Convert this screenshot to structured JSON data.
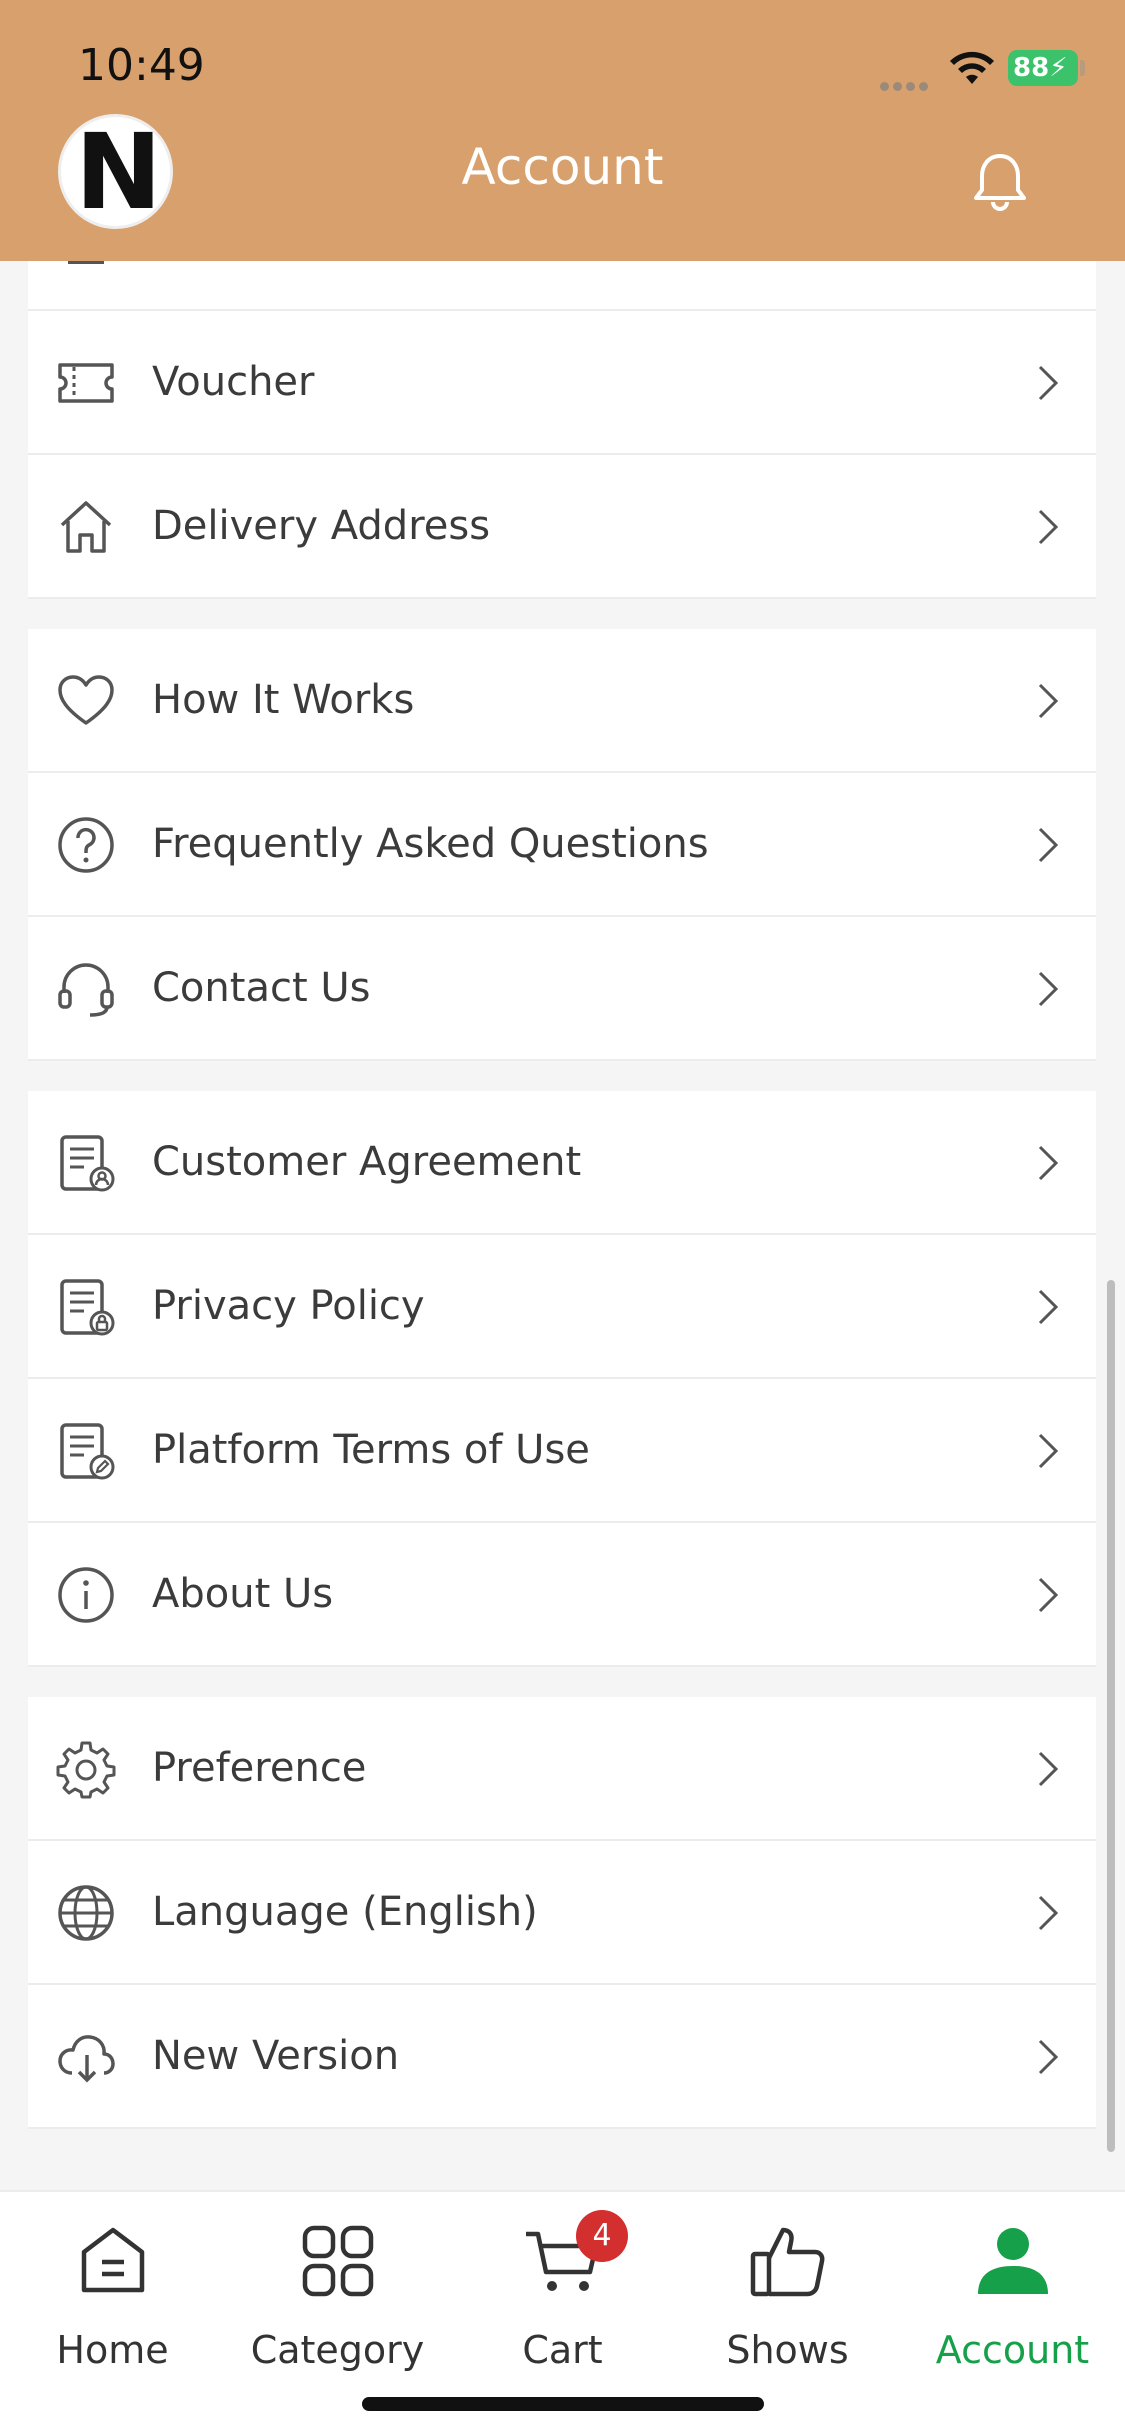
{
  "status_bar": {
    "time": "10:49",
    "battery": "88"
  },
  "header": {
    "logo_letter": "N",
    "title": "Account"
  },
  "groups": [
    {
      "items": [
        {
          "id": "voucher",
          "label": "Voucher",
          "icon": "ticket-icon"
        },
        {
          "id": "delivery-address",
          "label": "Delivery Address",
          "icon": "home-icon"
        }
      ]
    },
    {
      "items": [
        {
          "id": "how-it-works",
          "label": "How It Works",
          "icon": "heart-icon"
        },
        {
          "id": "faq",
          "label": "Frequently Asked Questions",
          "icon": "question-circle-icon"
        },
        {
          "id": "contact-us",
          "label": "Contact Us",
          "icon": "headset-icon"
        }
      ]
    },
    {
      "items": [
        {
          "id": "customer-agreement",
          "label": "Customer Agreement",
          "icon": "document-user-icon"
        },
        {
          "id": "privacy-policy",
          "label": "Privacy Policy",
          "icon": "document-lock-icon"
        },
        {
          "id": "platform-terms",
          "label": "Platform Terms of Use",
          "icon": "document-edit-icon"
        },
        {
          "id": "about-us",
          "label": "About Us",
          "icon": "info-circle-icon"
        }
      ]
    },
    {
      "items": [
        {
          "id": "preference",
          "label": "Preference",
          "icon": "gear-icon"
        },
        {
          "id": "language",
          "label": "Language (English)",
          "icon": "globe-icon"
        },
        {
          "id": "new-version",
          "label": "New Version",
          "icon": "cloud-download-icon"
        }
      ]
    }
  ],
  "tabbar": {
    "tabs": [
      {
        "id": "home",
        "label": "Home",
        "icon": "home-tab-icon"
      },
      {
        "id": "category",
        "label": "Category",
        "icon": "grid-icon"
      },
      {
        "id": "cart",
        "label": "Cart",
        "icon": "cart-icon",
        "badge": "4"
      },
      {
        "id": "shows",
        "label": "Shows",
        "icon": "thumbs-up-icon"
      },
      {
        "id": "account",
        "label": "Account",
        "icon": "user-icon",
        "active": true
      }
    ]
  },
  "colors": {
    "header": "#d8a06c",
    "active": "#17a04a",
    "badge": "#d32f2f"
  }
}
